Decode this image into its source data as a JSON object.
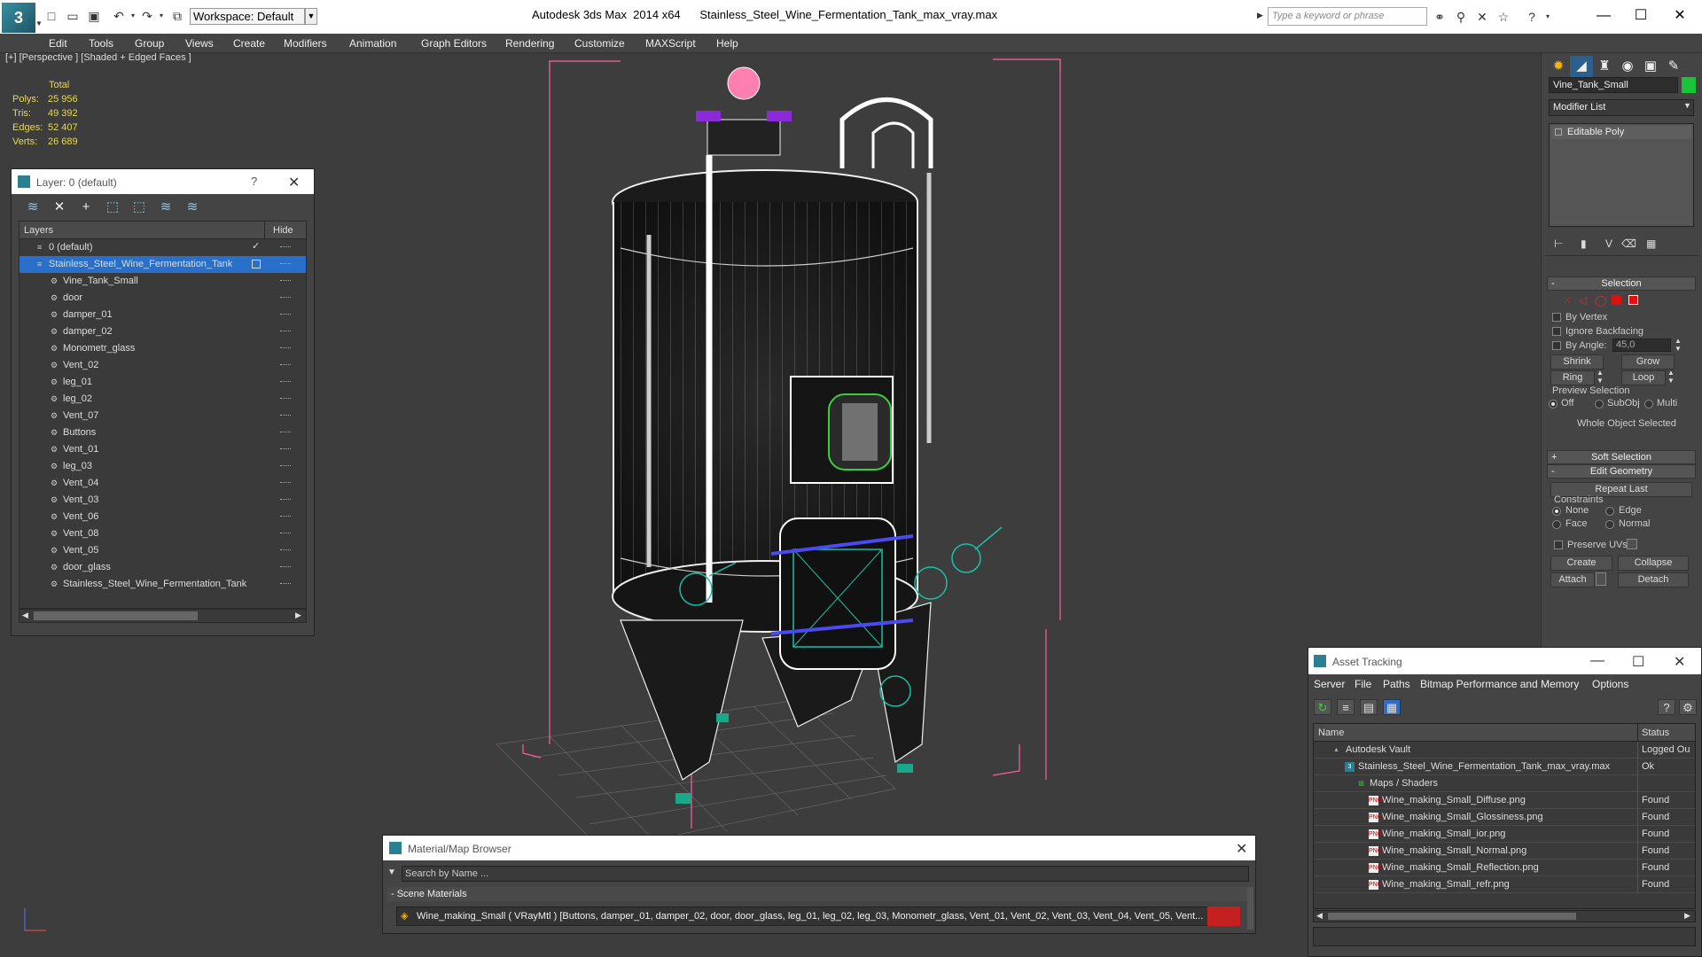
{
  "titlebar": {
    "app_title": "Autodesk 3ds Max  2014 x64      Stainless_Steel_Wine_Fermentation_Tank_max_vray.max",
    "workspace": "Workspace: Default",
    "search_placeholder": "Type a keyword or phrase"
  },
  "menu": [
    "Edit",
    "Tools",
    "Group",
    "Views",
    "Create",
    "Modifiers",
    "Animation",
    "Graph Editors",
    "Rendering",
    "Customize",
    "MAXScript",
    "Help"
  ],
  "viewport": {
    "label": "[+] [Perspective ] [Shaded + Edged Faces ]",
    "stats": {
      "header": "Total",
      "rows": [
        {
          "label": "Polys:",
          "value": "25 956"
        },
        {
          "label": "Tris:",
          "value": "49 392"
        },
        {
          "label": "Edges:",
          "value": "52 407"
        },
        {
          "label": "Verts:",
          "value": "26 689"
        }
      ]
    }
  },
  "layer_dialog": {
    "title": "Layer: 0 (default)",
    "help": "?",
    "col_layers": "Layers",
    "col_hide": "Hide",
    "rows": [
      {
        "name": "0 (default)",
        "level": 0,
        "kind": "layer"
      },
      {
        "name": "Stainless_Steel_Wine_Fermentation_Tank",
        "level": 0,
        "kind": "layer",
        "selected": true
      },
      {
        "name": "Vine_Tank_Small",
        "level": 1,
        "kind": "object"
      },
      {
        "name": "door",
        "level": 1,
        "kind": "object"
      },
      {
        "name": "damper_01",
        "level": 1,
        "kind": "object"
      },
      {
        "name": "damper_02",
        "level": 1,
        "kind": "object"
      },
      {
        "name": "Monometr_glass",
        "level": 1,
        "kind": "object"
      },
      {
        "name": "Vent_02",
        "level": 1,
        "kind": "object"
      },
      {
        "name": "leg_01",
        "level": 1,
        "kind": "object"
      },
      {
        "name": "leg_02",
        "level": 1,
        "kind": "object"
      },
      {
        "name": "Vent_07",
        "level": 1,
        "kind": "object"
      },
      {
        "name": "Buttons",
        "level": 1,
        "kind": "object"
      },
      {
        "name": "Vent_01",
        "level": 1,
        "kind": "object"
      },
      {
        "name": "leg_03",
        "level": 1,
        "kind": "object"
      },
      {
        "name": "Vent_04",
        "level": 1,
        "kind": "object"
      },
      {
        "name": "Vent_03",
        "level": 1,
        "kind": "object"
      },
      {
        "name": "Vent_06",
        "level": 1,
        "kind": "object"
      },
      {
        "name": "Vent_08",
        "level": 1,
        "kind": "object"
      },
      {
        "name": "Vent_05",
        "level": 1,
        "kind": "object"
      },
      {
        "name": "door_glass",
        "level": 1,
        "kind": "object"
      },
      {
        "name": "Stainless_Steel_Wine_Fermentation_Tank",
        "level": 1,
        "kind": "object"
      }
    ]
  },
  "command_panel": {
    "object_name": "Vine_Tank_Small",
    "object_color": "#19c43a",
    "modifier_list": "Modifier List",
    "stack_item": "Editable Poly",
    "selection": {
      "title": "Selection",
      "by_vertex": "By Vertex",
      "ignore_backfacing": "Ignore Backfacing",
      "by_angle": "By Angle:",
      "angle_value": "45,0",
      "shrink": "Shrink",
      "grow": "Grow",
      "ring": "Ring",
      "loop": "Loop",
      "preview_selection": "Preview Selection",
      "off": "Off",
      "subobj": "SubObj",
      "multi": "Multi",
      "status": "Whole Object Selected"
    },
    "soft_selection": "Soft Selection",
    "edit_geometry": {
      "title": "Edit Geometry",
      "repeat_last": "Repeat Last",
      "constraints": "Constraints",
      "none": "None",
      "edge": "Edge",
      "face": "Face",
      "normal": "Normal",
      "preserve_uvs": "Preserve UVs",
      "create": "Create",
      "collapse": "Collapse",
      "attach": "Attach",
      "detach": "Detach"
    }
  },
  "asset_tracking": {
    "title": "Asset Tracking",
    "menu": [
      "Server",
      "File",
      "Paths",
      "Bitmap Performance and Memory",
      "Options"
    ],
    "col_name": "Name",
    "col_status": "Status",
    "rows": [
      {
        "name": "Autodesk Vault",
        "status": "Logged Ou",
        "level": 0,
        "icon": "vault"
      },
      {
        "name": "Stainless_Steel_Wine_Fermentation_Tank_max_vray.max",
        "status": "Ok",
        "level": 1,
        "icon": "max"
      },
      {
        "name": "Maps / Shaders",
        "status": "",
        "level": 2,
        "icon": "maps"
      },
      {
        "name": "Wine_making_Small_Diffuse.png",
        "status": "Found",
        "level": 3,
        "icon": "png"
      },
      {
        "name": "Wine_making_Small_Glossiness.png",
        "status": "Found",
        "level": 3,
        "icon": "png"
      },
      {
        "name": "Wine_making_Small_ior.png",
        "status": "Found",
        "level": 3,
        "icon": "png"
      },
      {
        "name": "Wine_making_Small_Normal.png",
        "status": "Found",
        "level": 3,
        "icon": "png"
      },
      {
        "name": "Wine_making_Small_Reflection.png",
        "status": "Found",
        "level": 3,
        "icon": "png"
      },
      {
        "name": "Wine_making_Small_refr.png",
        "status": "Found",
        "level": 3,
        "icon": "png"
      }
    ]
  },
  "material_browser": {
    "title": "Material/Map Browser",
    "search_placeholder": "Search by Name ...",
    "section": "- Scene Materials",
    "item": "Wine_making_Small  ( VRayMtl )  [Buttons, damper_01, damper_02, door, door_glass, leg_01, leg_02, leg_03, Monometr_glass, Vent_01, Vent_02, Vent_03, Vent_04, Vent_05, Vent..."
  }
}
